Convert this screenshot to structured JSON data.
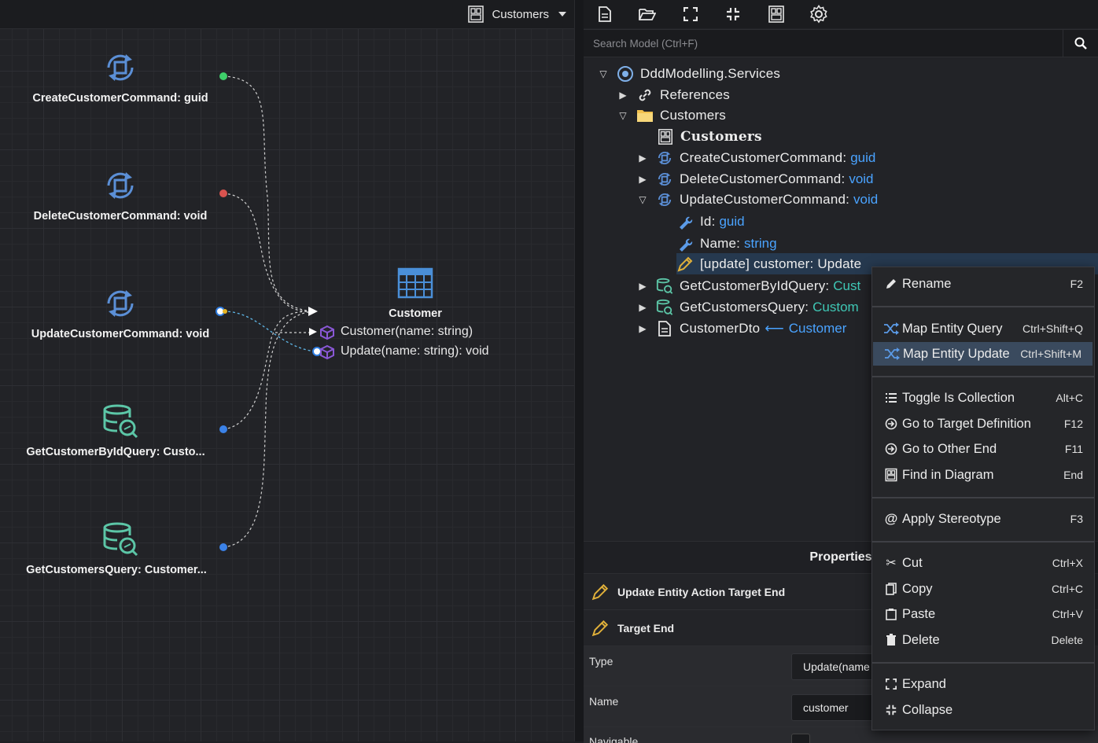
{
  "diagram": {
    "selector_label": "Customers",
    "nodes": [
      {
        "label": "CreateCustomerCommand: guid",
        "kind": "command"
      },
      {
        "label": "DeleteCustomerCommand: void",
        "kind": "command"
      },
      {
        "label": "UpdateCustomerCommand: void",
        "kind": "command"
      },
      {
        "label": "GetCustomerByIdQuery: Custo...",
        "kind": "query"
      },
      {
        "label": "GetCustomersQuery: Customer...",
        "kind": "query"
      }
    ],
    "entity": {
      "title": "Customer",
      "ops": [
        "Customer(name: string)",
        "Update(name: string): void"
      ]
    }
  },
  "toolbar": {
    "buttons": [
      "new-file-icon",
      "open-folder-icon",
      "expand-icon",
      "collapse-icon",
      "diagram-icon",
      "settings-icon"
    ]
  },
  "search": {
    "placeholder": "Search Model (Ctrl+F)"
  },
  "tree": {
    "root": "DddModelling.Services",
    "references": "References",
    "folder": "Customers",
    "diagram": "Customers",
    "create_cmd": {
      "name": "CreateCustomerCommand",
      "type": "guid"
    },
    "delete_cmd": {
      "name": "DeleteCustomerCommand",
      "type": "void"
    },
    "update_cmd": {
      "name": "UpdateCustomerCommand",
      "type": "void"
    },
    "field_id": {
      "name": "Id",
      "type": "guid"
    },
    "field_name": {
      "name": "Name",
      "type": "string"
    },
    "update_assoc": "[update] customer: Update",
    "query_byid": {
      "name": "GetCustomerByIdQuery",
      "type": "Cust"
    },
    "query_all": {
      "name": "GetCustomersQuery",
      "type": "Custom"
    },
    "dto": {
      "name": "CustomerDto",
      "type": "Customer"
    }
  },
  "properties": {
    "title": "Properties",
    "sections": [
      "Update Entity Action Target End",
      "Target End"
    ],
    "type_label": "Type",
    "type_value": "Update(name",
    "name_label": "Name",
    "name_value": "customer",
    "navigable_label": "Navigable"
  },
  "context_menu": {
    "items": [
      {
        "label": "Rename",
        "shortcut": "F2"
      },
      {
        "label": "Map Entity Query",
        "shortcut": "Ctrl+Shift+Q"
      },
      {
        "label": "Map Entity Update",
        "shortcut": "Ctrl+Shift+M"
      },
      {
        "label": "Toggle Is Collection",
        "shortcut": "Alt+C"
      },
      {
        "label": "Go to Target Definition",
        "shortcut": "F12"
      },
      {
        "label": "Go to Other End",
        "shortcut": "F11"
      },
      {
        "label": "Find in Diagram",
        "shortcut": "End"
      },
      {
        "label": "Apply Stereotype",
        "shortcut": "F3"
      },
      {
        "label": "Cut",
        "shortcut": "Ctrl+X"
      },
      {
        "label": "Copy",
        "shortcut": "Ctrl+C"
      },
      {
        "label": "Paste",
        "shortcut": "Ctrl+V"
      },
      {
        "label": "Delete",
        "shortcut": "Delete"
      },
      {
        "label": "Expand",
        "shortcut": ""
      },
      {
        "label": "Collapse",
        "shortcut": ""
      }
    ]
  },
  "colors": {
    "accent_blue": "#4aa3ff",
    "type_teal": "#3fc7b5",
    "command_icon": "#5b8fd6",
    "query_icon": "#5cc6a7",
    "highlight": "#3a4a5e"
  }
}
